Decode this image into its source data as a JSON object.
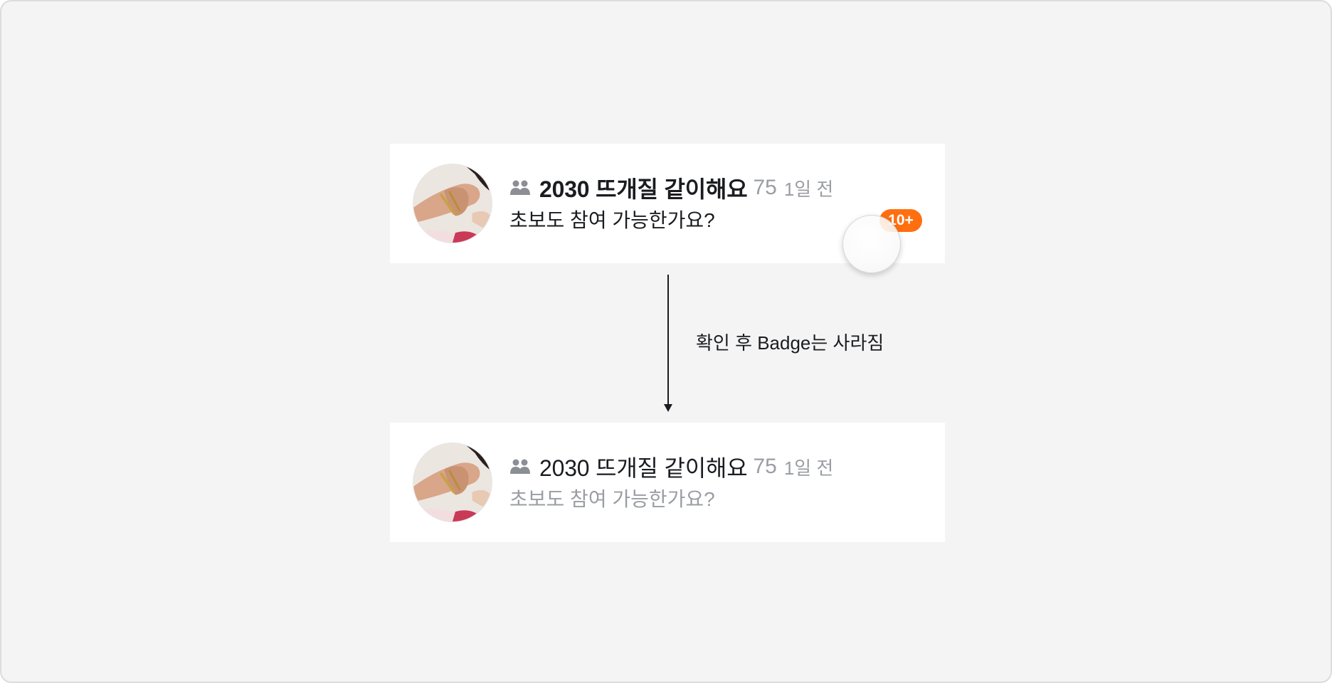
{
  "before": {
    "title": "2030 뜨개질 같이해요",
    "member_count": "75",
    "time_ago": "1일 전",
    "last_message": "초보도 참여 가능한가요?",
    "badge": "10+",
    "avatar_icon": "knitting-photo",
    "group_icon": "group-members-icon"
  },
  "transition": {
    "note": "확인 후 Badge는 사라짐"
  },
  "after": {
    "title": "2030 뜨개질 같이해요",
    "member_count": "75",
    "time_ago": "1일 전",
    "last_message": "초보도 참여 가능한가요?",
    "avatar_icon": "knitting-photo",
    "group_icon": "group-members-icon"
  },
  "colors": {
    "badge": "#ff6f0f",
    "text_primary": "#1a1c20",
    "text_secondary": "#9a9da3",
    "background": "#f4f4f4"
  }
}
